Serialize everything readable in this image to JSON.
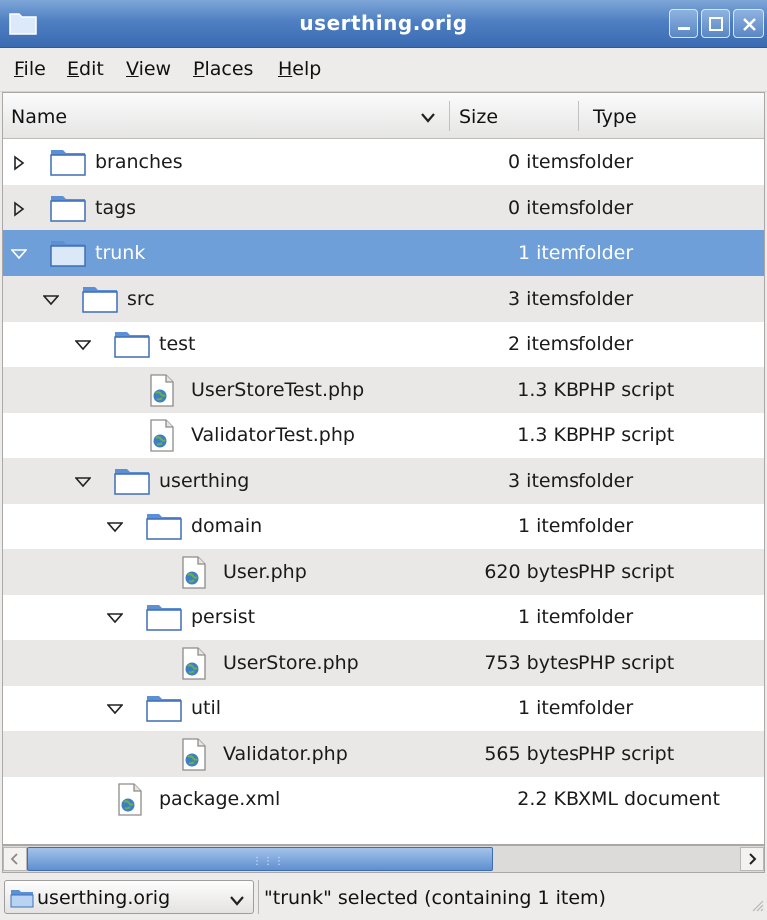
{
  "window": {
    "title": "userthing.orig"
  },
  "menu": [
    "File",
    "Edit",
    "View",
    "Places",
    "Help"
  ],
  "columns": {
    "name": "Name",
    "size": "Size",
    "type": "Type"
  },
  "rows": [
    {
      "name": "branches",
      "size": "0 items",
      "type": "folder",
      "kind": "folder",
      "depth": 0,
      "expander": "collapsed"
    },
    {
      "name": "tags",
      "size": "0 items",
      "type": "folder",
      "kind": "folder",
      "depth": 0,
      "expander": "collapsed"
    },
    {
      "name": "trunk",
      "size": "1 item",
      "type": "folder",
      "kind": "folder",
      "depth": 0,
      "expander": "expanded",
      "selected": true
    },
    {
      "name": "src",
      "size": "3 items",
      "type": "folder",
      "kind": "folder",
      "depth": 1,
      "expander": "expanded"
    },
    {
      "name": "test",
      "size": "2 items",
      "type": "folder",
      "kind": "folder",
      "depth": 2,
      "expander": "expanded"
    },
    {
      "name": "UserStoreTest.php",
      "size": "1.3 KB",
      "type": "PHP script",
      "kind": "php",
      "depth": 3
    },
    {
      "name": "ValidatorTest.php",
      "size": "1.3 KB",
      "type": "PHP script",
      "kind": "php",
      "depth": 3
    },
    {
      "name": "userthing",
      "size": "3 items",
      "type": "folder",
      "kind": "folder",
      "depth": 2,
      "expander": "expanded"
    },
    {
      "name": "domain",
      "size": "1 item",
      "type": "folder",
      "kind": "folder",
      "depth": 3,
      "expander": "expanded"
    },
    {
      "name": "User.php",
      "size": "620 bytes",
      "type": "PHP script",
      "kind": "php",
      "depth": 4
    },
    {
      "name": "persist",
      "size": "1 item",
      "type": "folder",
      "kind": "folder",
      "depth": 3,
      "expander": "expanded"
    },
    {
      "name": "UserStore.php",
      "size": "753 bytes",
      "type": "PHP script",
      "kind": "php",
      "depth": 4
    },
    {
      "name": "util",
      "size": "1 item",
      "type": "folder",
      "kind": "folder",
      "depth": 3,
      "expander": "expanded"
    },
    {
      "name": "Validator.php",
      "size": "565 bytes",
      "type": "PHP script",
      "kind": "php",
      "depth": 4
    },
    {
      "name": "package.xml",
      "size": "2.2 KB",
      "type": "XML document",
      "kind": "xml",
      "depth": 2
    }
  ],
  "statusbar": {
    "location": "userthing.orig",
    "message": "\"trunk\" selected (containing 1 item)"
  },
  "colors": {
    "selection": "#6f9fd8",
    "titlebar": "#4f7fc2",
    "folder": "#5b8fd6"
  }
}
